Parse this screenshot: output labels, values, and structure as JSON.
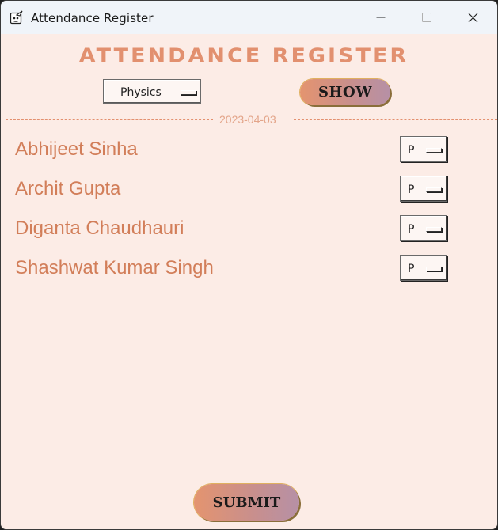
{
  "window": {
    "title": "Attendance Register"
  },
  "header": {
    "heading": "ATTENDANCE REGISTER"
  },
  "controls": {
    "subject_selected": "Physics",
    "show_label": "SHOW"
  },
  "date": "2023-04-03",
  "students": [
    {
      "name": "Abhijeet Sinha",
      "status": "P"
    },
    {
      "name": "Archit Gupta",
      "status": "P"
    },
    {
      "name": "Diganta Chaudhauri",
      "status": "P"
    },
    {
      "name": "Shashwat Kumar Singh",
      "status": "P"
    }
  ],
  "footer": {
    "submit_label": "SUBMIT"
  },
  "colors": {
    "background": "#fcece6",
    "accent": "#e2906f",
    "name_text": "#d27e59",
    "button_gradient_start": "#e4946f",
    "button_gradient_end": "#b690a6"
  }
}
